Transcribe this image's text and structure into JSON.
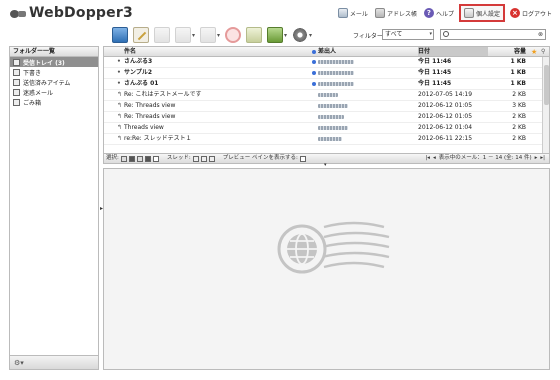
{
  "app": {
    "logo_text": "WebDopper3"
  },
  "header_links": [
    {
      "label": "メール",
      "icon": "mail-icon"
    },
    {
      "label": "アドレス帳",
      "icon": "addressbook-icon"
    },
    {
      "label": "ヘルプ",
      "icon": "help-icon"
    },
    {
      "label": "個人設定",
      "icon": "settings-icon",
      "active": true
    },
    {
      "label": "ログアウト",
      "icon": "logout-icon"
    }
  ],
  "toolbar": {
    "filter_label": "フィルター:",
    "filter_value": "すべて",
    "search_placeholder": "Q▾"
  },
  "sidebar": {
    "header": "フォルダー一覧",
    "items": [
      {
        "label": "受信トレイ (3)",
        "icon": "inbox-icon",
        "selected": true
      },
      {
        "label": "下書き",
        "icon": "drafts-icon"
      },
      {
        "label": "送信済みアイテム",
        "icon": "sent-icon"
      },
      {
        "label": "迷惑メール",
        "icon": "junk-icon"
      },
      {
        "label": "ごみ箱",
        "icon": "trash-icon"
      }
    ]
  },
  "messages": {
    "columns": {
      "subject": "件名",
      "from": "差出人",
      "date": "日付",
      "size": "容量"
    },
    "rows": [
      {
        "subject": "さんぷる3",
        "date": "今日 11:46",
        "size": "1 KB",
        "unread": true
      },
      {
        "subject": "サンプル2",
        "date": "今日 11:45",
        "size": "1 KB",
        "unread": true
      },
      {
        "subject": "さんぷる 01",
        "date": "今日 11:45",
        "size": "1 KB",
        "unread": true
      },
      {
        "subject": "Re: これはテストメールです",
        "date": "2012-07-05 14:19",
        "size": "2 KB",
        "unread": false
      },
      {
        "subject": "Re: Threads view",
        "date": "2012-06-12 01:05",
        "size": "3 KB",
        "unread": false
      },
      {
        "subject": "Re: Threads view",
        "date": "2012-06-12 01:05",
        "size": "2 KB",
        "unread": false
      },
      {
        "subject": "Threads view",
        "date": "2012-06-12 01:04",
        "size": "2 KB",
        "unread": false
      },
      {
        "subject": "re:Re: スレッドテスト１",
        "date": "2012-06-11 22:15",
        "size": "2 KB",
        "unread": false
      }
    ],
    "footer": {
      "select_label": "選択:",
      "thread_label": "スレッド:",
      "preview_label": "プレビュー ペインを表示する:",
      "count_label": "表示中のメール：1 － 14 (全: 14 件)"
    }
  },
  "colors": {
    "accent_red": "#d43a3a",
    "unread_dot": "#3b6fd8"
  }
}
